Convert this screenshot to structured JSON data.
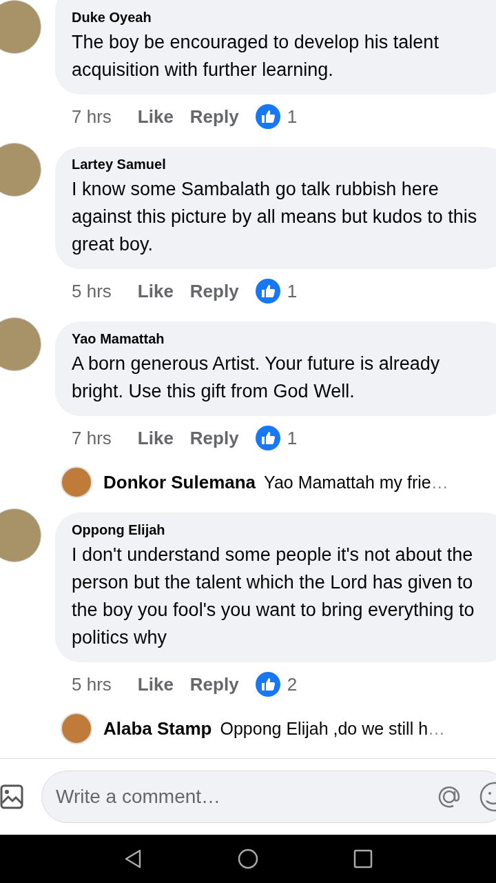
{
  "comments": [
    {
      "author": "Duke Oyeah",
      "text": "The boy be encouraged to develop his talent acquisition with further learning.",
      "time": "7 hrs",
      "like": "Like",
      "reply": "Reply",
      "reactions": "1"
    },
    {
      "author": "Lartey Samuel",
      "text": "I know some Sambalath go talk rubbish here against this picture by all means but kudos to this great boy.",
      "time": "5 hrs",
      "like": "Like",
      "reply": "Reply",
      "reactions": "1"
    },
    {
      "author": "Yao Mamattah",
      "text": "A born generous Artist. Your future is already bright. Use this gift from God Well.",
      "time": "7 hrs",
      "like": "Like",
      "reply": "Reply",
      "reactions": "1",
      "replies": [
        {
          "author": "Donkor Sulemana",
          "text": "Yao Mamattah my frie",
          "ellipsis": "…"
        }
      ]
    },
    {
      "author": "Oppong Elijah",
      "text": "I don't understand some people it's not about the person but the talent which the Lord has given to the boy you fool's you want to bring everything to politics why",
      "time": "5 hrs",
      "like": "Like",
      "reply": "Reply",
      "reactions": "2",
      "replies": [
        {
          "author": "Alaba Stamp",
          "text": "Oppong Elijah ,do we still h",
          "ellipsis": "…"
        }
      ]
    }
  ],
  "composer": {
    "placeholder": "Write a comment…"
  }
}
